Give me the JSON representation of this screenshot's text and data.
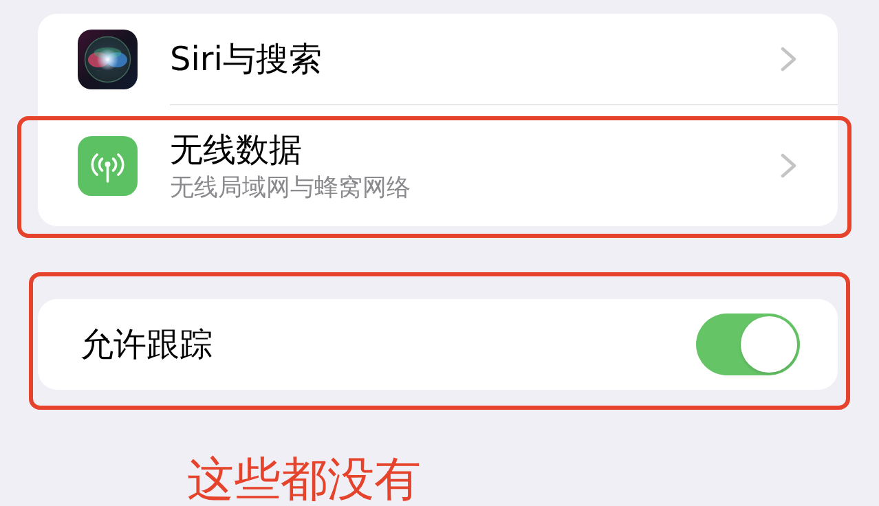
{
  "groups": [
    {
      "rows": [
        {
          "kind": "link",
          "title": "Siri与搜索",
          "highlighted": false
        },
        {
          "kind": "link",
          "title": "无线数据",
          "subtitle": "无线局域网与蜂窝网络",
          "highlighted": true
        }
      ]
    },
    {
      "rows": [
        {
          "kind": "toggle",
          "title": "允许跟踪",
          "on": true,
          "highlighted": true
        }
      ]
    }
  ],
  "annotation_note": "这些都没有"
}
